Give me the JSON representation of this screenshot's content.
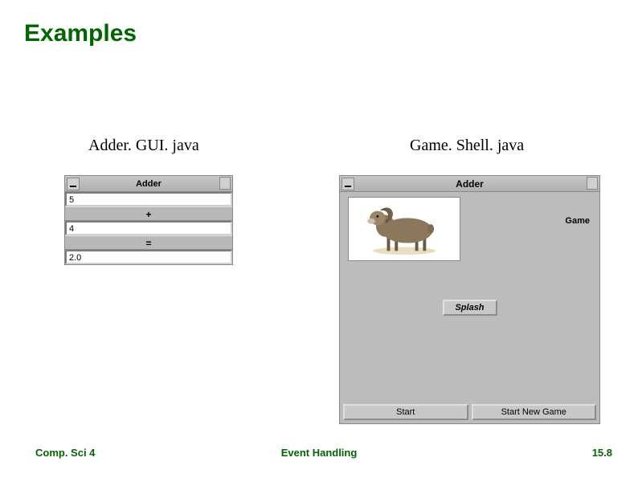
{
  "slide": {
    "title": "Examples",
    "left_label": "Adder. GUI. java",
    "right_label": "Game. Shell. java"
  },
  "adder": {
    "window_title": "Adder",
    "field1": "5",
    "plus": "+",
    "field2": "4",
    "equals": "=",
    "result": "2.0"
  },
  "game": {
    "window_title": "Adder",
    "side_label": "Game",
    "splash_button": "Splash",
    "start_button": "Start",
    "newgame_button": "Start New Game"
  },
  "footer": {
    "left": "Comp. Sci 4",
    "center": "Event Handling",
    "right": "15.8"
  }
}
